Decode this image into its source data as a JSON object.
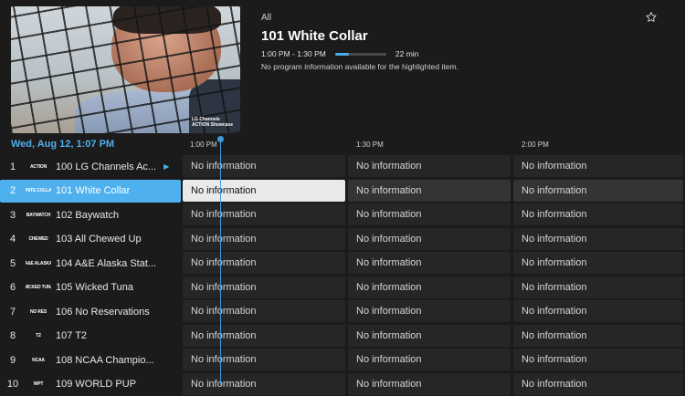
{
  "preview": {
    "logo_line1": "LG Channels",
    "logo_line2": "ACTION Showcase"
  },
  "info": {
    "category": "All",
    "title": "101 White Collar",
    "time_range": "1:00 PM - 1:30 PM",
    "progress": 0.27,
    "remaining": "22 min",
    "description": "No program information available for the highlighted item.",
    "favorite_icon": "star-outline-icon"
  },
  "guide": {
    "date": "Wed, Aug 12, 1:07 PM",
    "times": [
      "1:00 PM",
      "1:30 PM",
      "2:00 PM"
    ],
    "accent_color": "#4fb0ee",
    "channels": [
      {
        "num": "1",
        "logo": "ACTION",
        "name": "100 LG Channels Ac...",
        "has_arrow": true,
        "cells": [
          "No information",
          "No information",
          "No information"
        ]
      },
      {
        "num": "2",
        "logo": "WHITE COLLAR",
        "name": "101 White Collar",
        "selected": true,
        "cells": [
          "No information",
          "No information",
          "No information"
        ]
      },
      {
        "num": "3",
        "logo": "BAYWATCH",
        "name": "102 Baywatch",
        "cells": [
          "No information",
          "No information",
          "No information"
        ]
      },
      {
        "num": "4",
        "logo": "CHEWED",
        "name": "103 All Chewed Up",
        "cells": [
          "No information",
          "No information",
          "No information"
        ]
      },
      {
        "num": "5",
        "logo": "A&E ALASKA",
        "name": "104 A&E Alaska Stat...",
        "cells": [
          "No information",
          "No information",
          "No information"
        ]
      },
      {
        "num": "6",
        "logo": "WICKED TUNA",
        "name": "105 Wicked Tuna",
        "cells": [
          "No information",
          "No information",
          "No information"
        ]
      },
      {
        "num": "7",
        "logo": "NO RES",
        "name": "106 No Reservations",
        "cells": [
          "No information",
          "No information",
          "No information"
        ]
      },
      {
        "num": "8",
        "logo": "T2",
        "name": "107 T2",
        "cells": [
          "No information",
          "No information",
          "No information"
        ]
      },
      {
        "num": "9",
        "logo": "NCAA",
        "name": "108 NCAA Champio...",
        "cells": [
          "No information",
          "No information",
          "No information"
        ]
      },
      {
        "num": "10",
        "logo": "WPT",
        "name": "109 WORLD PUP",
        "cells": [
          "No information",
          "No information",
          "No information"
        ]
      }
    ]
  }
}
